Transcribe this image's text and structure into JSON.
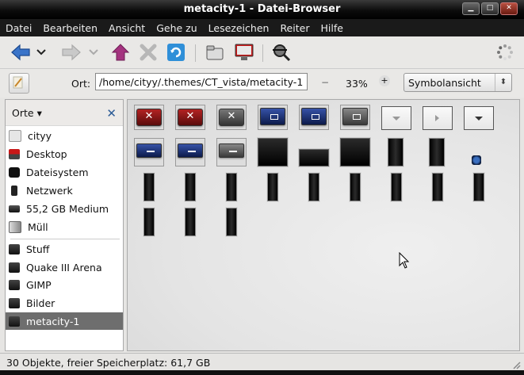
{
  "window": {
    "title": "metacity-1 - Datei-Browser",
    "buttons": [
      "minimize",
      "maximize",
      "close"
    ]
  },
  "menubar": {
    "items": [
      {
        "label": "Datei"
      },
      {
        "label": "Bearbeiten"
      },
      {
        "label": "Ansicht"
      },
      {
        "label": "Gehe zu"
      },
      {
        "label": "Lesezeichen"
      },
      {
        "label": "Reiter"
      },
      {
        "label": "Hilfe"
      }
    ]
  },
  "toolbar": {
    "buttons": [
      "back-icon",
      "back-dropdown-icon",
      "forward-icon",
      "forward-dropdown-icon",
      "up-icon",
      "stop-icon",
      "reload-icon",
      "home-icon",
      "computer-icon",
      "search-icon",
      "spinner-icon"
    ]
  },
  "location": {
    "label": "Ort:",
    "path": "/home/cityy/.themes/CT_vista/metacity-1",
    "zoom": "33%",
    "view_mode": "Symbolansicht"
  },
  "sidebar": {
    "header": "Orte",
    "items": [
      {
        "label": "cityy",
        "icon": "home-folder-icon"
      },
      {
        "label": "Desktop",
        "icon": "desktop-icon"
      },
      {
        "label": "Dateisystem",
        "icon": "filesystem-icon"
      },
      {
        "label": "Netzwerk",
        "icon": "network-icon"
      },
      {
        "label": "55,2 GB Medium",
        "icon": "drive-icon"
      },
      {
        "label": "Müll",
        "icon": "trash-icon"
      }
    ],
    "bookmarks": [
      {
        "label": "Stuff",
        "icon": "folder-icon"
      },
      {
        "label": "Quake III Arena",
        "icon": "folder-icon"
      },
      {
        "label": "GIMP",
        "icon": "folder-icon"
      },
      {
        "label": "Bilder",
        "icon": "folder-icon"
      },
      {
        "label": "metacity-1",
        "icon": "folder-icon",
        "selected": true
      }
    ]
  },
  "status": {
    "text": "30 Objekte, freier Speicherplatz: 61,7 GB"
  },
  "colors": {
    "titlebar": "#000000",
    "menubar": "#1a1a1a",
    "selection": "#6e6e6e",
    "accent_blue": "#2c5b96",
    "red_button": "#a01818"
  }
}
